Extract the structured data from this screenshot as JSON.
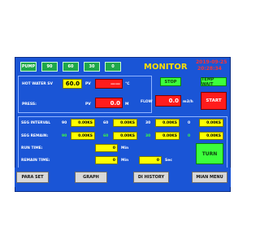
{
  "top_buttons": [
    "PUMP",
    "90",
    "60",
    "30",
    "0"
  ],
  "title": "MONITOR",
  "datetime": {
    "date": "2019-09-25",
    "time": "20:28:34"
  },
  "controls": {
    "stop": "STOP",
    "temp_wait": "TEMP WAIT",
    "start": "START",
    "turn": "TURN"
  },
  "hot_water": {
    "label": "HOT WATER SV",
    "sv": "60.0",
    "pv_label": "PV",
    "unit": "℃"
  },
  "press": {
    "label": "PRESS:",
    "pv_label": "PV",
    "value": "0.0",
    "unit": "M"
  },
  "flow": {
    "label": "FLOW",
    "value": "0.0",
    "unit": "m3/h"
  },
  "segments": {
    "interval_label": "SEG INTERVAL",
    "remain_label": "SEG REMAIN:",
    "interval_cells": [
      {
        "num": "90",
        "value": "0.00KS"
      },
      {
        "num": "60",
        "value": "0.00KS"
      },
      {
        "num": "30",
        "value": "0.00KS"
      },
      {
        "num": "0",
        "value": "0.00KS"
      }
    ],
    "remain_cells": [
      {
        "num": "90",
        "value": "0.00KS"
      },
      {
        "num": "60",
        "value": "0.00KS"
      },
      {
        "num": "30",
        "value": "0.00KS"
      },
      {
        "num": "0",
        "value": "0.00KS"
      }
    ]
  },
  "run_time": {
    "label": "RUN TIME:",
    "value": "0",
    "unit": "Min"
  },
  "remain_time": {
    "label": "REMAIN TIME:",
    "min_value": "0",
    "min_unit": "Min",
    "sec_value": "0",
    "sec_unit": "Sec"
  },
  "nav": [
    "PARA SET",
    "GRAPH",
    "DI HISTORY",
    "MIAN MENU"
  ],
  "colors": {
    "panel": "#1a55d6",
    "green": "#3cff3c",
    "red": "#ff1c1c",
    "yellow": "#ffff00",
    "title": "#ffdf00"
  }
}
